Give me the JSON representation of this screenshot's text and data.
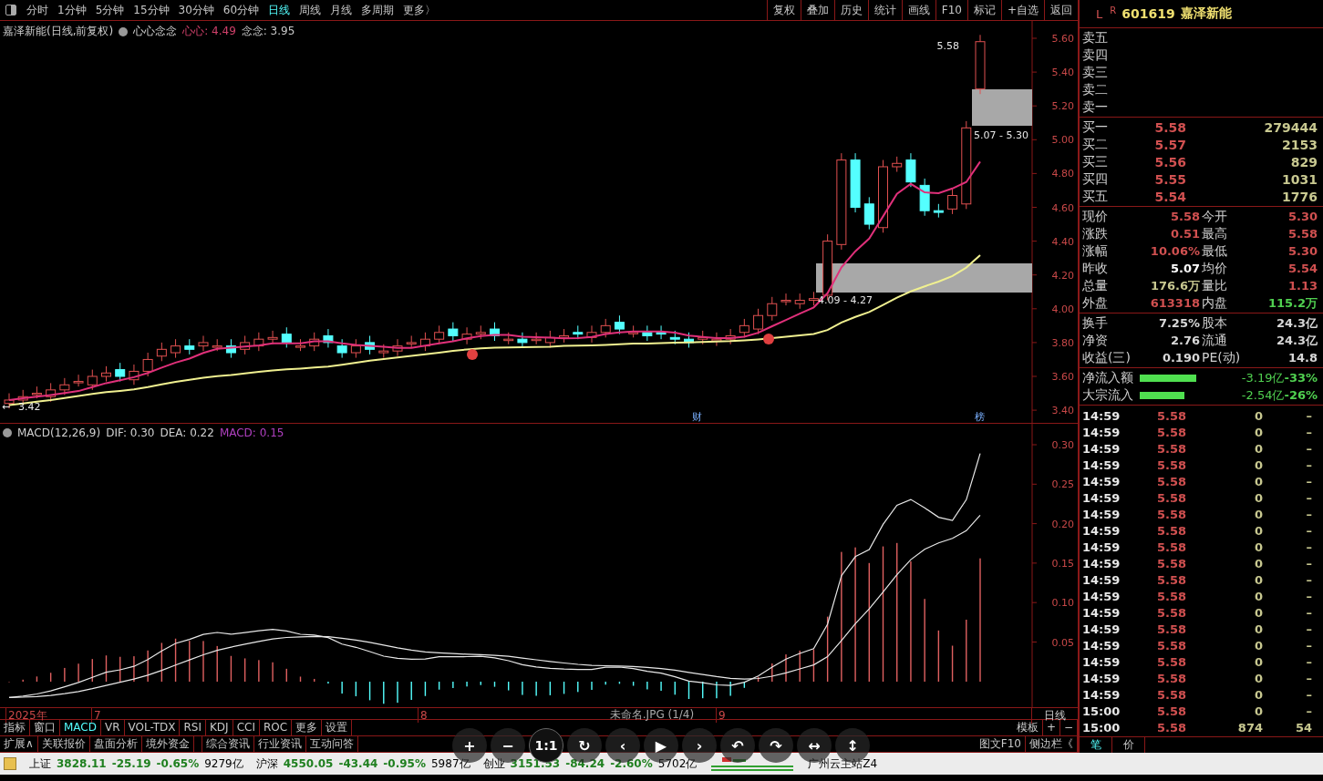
{
  "toolbar": {
    "periods": [
      {
        "label": "分时",
        "selected": false
      },
      {
        "label": "1分钟",
        "selected": false
      },
      {
        "label": "5分钟",
        "selected": false
      },
      {
        "label": "15分钟",
        "selected": false
      },
      {
        "label": "30分钟",
        "selected": false
      },
      {
        "label": "60分钟",
        "selected": false
      },
      {
        "label": "日线",
        "selected": true
      },
      {
        "label": "周线",
        "selected": false
      },
      {
        "label": "月线",
        "selected": false
      },
      {
        "label": "多周期",
        "selected": false
      },
      {
        "label": "更多〉",
        "selected": false
      }
    ],
    "actions": [
      "复权",
      "叠加",
      "历史",
      "统计",
      "画线",
      "F10",
      "标记",
      "+自选",
      "返回"
    ]
  },
  "chart_header": {
    "title": "嘉泽新能(日线,前复权)",
    "indicator": "心心念念",
    "readouts": [
      {
        "label": "心心:",
        "value": "4.49",
        "color": "#d0406a"
      },
      {
        "label": "念念:",
        "value": "3.95",
        "color": "#c8c8c8"
      }
    ]
  },
  "price_axis": [
    "5.60",
    "5.40",
    "5.20",
    "5.00",
    "4.80",
    "4.60",
    "4.40",
    "4.20",
    "4.00",
    "3.80",
    "3.60",
    "3.40"
  ],
  "chart_labels": {
    "high": "5.58",
    "low": "3.42",
    "low_arrow": "←",
    "zone_upper": "5.07 - 5.30",
    "zone_lower": "4.09 - 4.27",
    "markers": [
      "财",
      "榜"
    ]
  },
  "macd_header": {
    "title": "MACD(12,26,9)",
    "readouts": [
      {
        "text": "DIF: 0.30",
        "color": "#d0d0d0"
      },
      {
        "text": "DEA: 0.22",
        "color": "#d0d0d0"
      },
      {
        "text": "MACD: 0.15",
        "color": "#b040c0"
      }
    ]
  },
  "macd_axis": [
    "0.30",
    "0.25",
    "0.20",
    "0.15",
    "0.10",
    "0.05"
  ],
  "date_axis": {
    "labels": [
      "2025年",
      "7",
      "8",
      "9"
    ],
    "period": "日线"
  },
  "indicator_tabs": [
    {
      "label": "指标",
      "selected": false
    },
    {
      "label": "窗口",
      "selected": false
    },
    {
      "label": "MACD",
      "selected": true
    },
    {
      "label": "VR",
      "selected": false
    },
    {
      "label": "VOL-TDX",
      "selected": false
    },
    {
      "label": "RSI",
      "selected": false
    },
    {
      "label": "KDJ",
      "selected": false
    },
    {
      "label": "CCI",
      "selected": false
    },
    {
      "label": "ROC",
      "selected": false
    },
    {
      "label": "更多",
      "selected": false
    },
    {
      "label": "设置",
      "selected": false
    }
  ],
  "template_buttons": [
    "模板",
    "+",
    "−"
  ],
  "extension_tabs": [
    "扩展∧",
    "关联报价",
    "盘面分析",
    "境外资金",
    "综合资讯",
    "行业资讯",
    "互动问答"
  ],
  "side_buttons": [
    "图文F10",
    "侧边栏《"
  ],
  "viewer": {
    "title": "未命名.JPG (1/4)",
    "buttons": [
      "+",
      "−",
      "1:1",
      "↻",
      "‹",
      "▶",
      "›",
      "↶",
      "↷",
      "↔",
      "↕"
    ]
  },
  "quote": {
    "letter": "L",
    "badge": "R",
    "code": "601619",
    "name": "嘉泽新能",
    "sell": [
      "卖五",
      "卖四",
      "卖三",
      "卖二",
      "卖一"
    ],
    "buy": [
      {
        "label": "买一",
        "price": "5.58",
        "volume": "279444"
      },
      {
        "label": "买二",
        "price": "5.57",
        "volume": "2153"
      },
      {
        "label": "买三",
        "price": "5.56",
        "volume": "829"
      },
      {
        "label": "买四",
        "price": "5.55",
        "volume": "1031"
      },
      {
        "label": "买五",
        "price": "5.54",
        "volume": "1776"
      }
    ],
    "stats": [
      {
        "cells": [
          {
            "label": "现价",
            "value": "5.58",
            "color": "#d05050"
          },
          {
            "label": "今开",
            "value": "5.30",
            "color": "#d05050"
          }
        ]
      },
      {
        "cells": [
          {
            "label": "涨跌",
            "value": "0.51",
            "color": "#d05050"
          },
          {
            "label": "最高",
            "value": "5.58",
            "color": "#d05050"
          }
        ]
      },
      {
        "cells": [
          {
            "label": "涨幅",
            "value": "10.06%",
            "color": "#d05050"
          },
          {
            "label": "最低",
            "value": "5.30",
            "color": "#d05050"
          }
        ]
      },
      {
        "cells": [
          {
            "label": "昨收",
            "value": "5.07",
            "color": "#ffffff"
          },
          {
            "label": "均价",
            "value": "5.54",
            "color": "#d05050"
          }
        ]
      },
      {
        "cells": [
          {
            "label": "总量",
            "value": "176.6万",
            "color": "#c8c890"
          },
          {
            "label": "量比",
            "value": "1.13",
            "color": "#d05050"
          }
        ]
      },
      {
        "cells": [
          {
            "label": "外盘",
            "value": "613318",
            "color": "#d05050"
          },
          {
            "label": "内盘",
            "value": "115.2万",
            "color": "#50d050"
          }
        ]
      }
    ],
    "finance": [
      {
        "label": "换手",
        "value": "7.25%",
        "label2": "股本",
        "value2": "24.3亿"
      },
      {
        "label": "净资",
        "value": "2.76",
        "label2": "流通",
        "value2": "24.3亿"
      },
      {
        "label": "收益(三)",
        "value": "0.190",
        "label2": "PE(动)",
        "value2": "14.8"
      }
    ],
    "flows": [
      {
        "label": "净流入额",
        "level": 0.33,
        "amount": "-3.19亿",
        "pct": "-33%"
      },
      {
        "label": "大宗流入",
        "level": 0.26,
        "amount": "-2.54亿",
        "pct": "-26%"
      }
    ],
    "ticks": [
      {
        "time": "14:59",
        "price": "5.58",
        "volume": "0",
        "extra": "–"
      },
      {
        "time": "14:59",
        "price": "5.58",
        "volume": "0",
        "extra": "–"
      },
      {
        "time": "14:59",
        "price": "5.58",
        "volume": "0",
        "extra": "–"
      },
      {
        "time": "14:59",
        "price": "5.58",
        "volume": "0",
        "extra": "–"
      },
      {
        "time": "14:59",
        "price": "5.58",
        "volume": "0",
        "extra": "–"
      },
      {
        "time": "14:59",
        "price": "5.58",
        "volume": "0",
        "extra": "–"
      },
      {
        "time": "14:59",
        "price": "5.58",
        "volume": "0",
        "extra": "–"
      },
      {
        "time": "14:59",
        "price": "5.58",
        "volume": "0",
        "extra": "–"
      },
      {
        "time": "14:59",
        "price": "5.58",
        "volume": "0",
        "extra": "–"
      },
      {
        "time": "14:59",
        "price": "5.58",
        "volume": "0",
        "extra": "–"
      },
      {
        "time": "14:59",
        "price": "5.58",
        "volume": "0",
        "extra": "–"
      },
      {
        "time": "14:59",
        "price": "5.58",
        "volume": "0",
        "extra": "–"
      },
      {
        "time": "14:59",
        "price": "5.58",
        "volume": "0",
        "extra": "–"
      },
      {
        "time": "14:59",
        "price": "5.58",
        "volume": "0",
        "extra": "–"
      },
      {
        "time": "14:59",
        "price": "5.58",
        "volume": "0",
        "extra": "–"
      },
      {
        "time": "14:59",
        "price": "5.58",
        "volume": "0",
        "extra": "–"
      },
      {
        "time": "14:59",
        "price": "5.58",
        "volume": "0",
        "extra": "–"
      },
      {
        "time": "14:59",
        "price": "5.58",
        "volume": "0",
        "extra": "–"
      },
      {
        "time": "15:00",
        "price": "5.58",
        "volume": "0",
        "extra": "–"
      },
      {
        "time": "15:00",
        "price": "5.58",
        "volume": "874",
        "extra": "54"
      }
    ],
    "tabs": [
      {
        "label": "笔",
        "selected": true
      },
      {
        "label": "价",
        "selected": false
      }
    ]
  },
  "status_bar": {
    "indices": [
      {
        "name": "上证",
        "value": "3828.11",
        "change": "-25.19",
        "pct": "-0.65%",
        "amount": "9279亿"
      },
      {
        "name": "沪深",
        "value": "4550.05",
        "change": "-43.44",
        "pct": "-0.95%",
        "amount": "5987亿"
      },
      {
        "name": "创业",
        "value": "3151.53",
        "change": "-84.24",
        "pct": "-2.60%",
        "amount": "5702亿"
      }
    ],
    "server": "广州云主站Z4"
  }
}
